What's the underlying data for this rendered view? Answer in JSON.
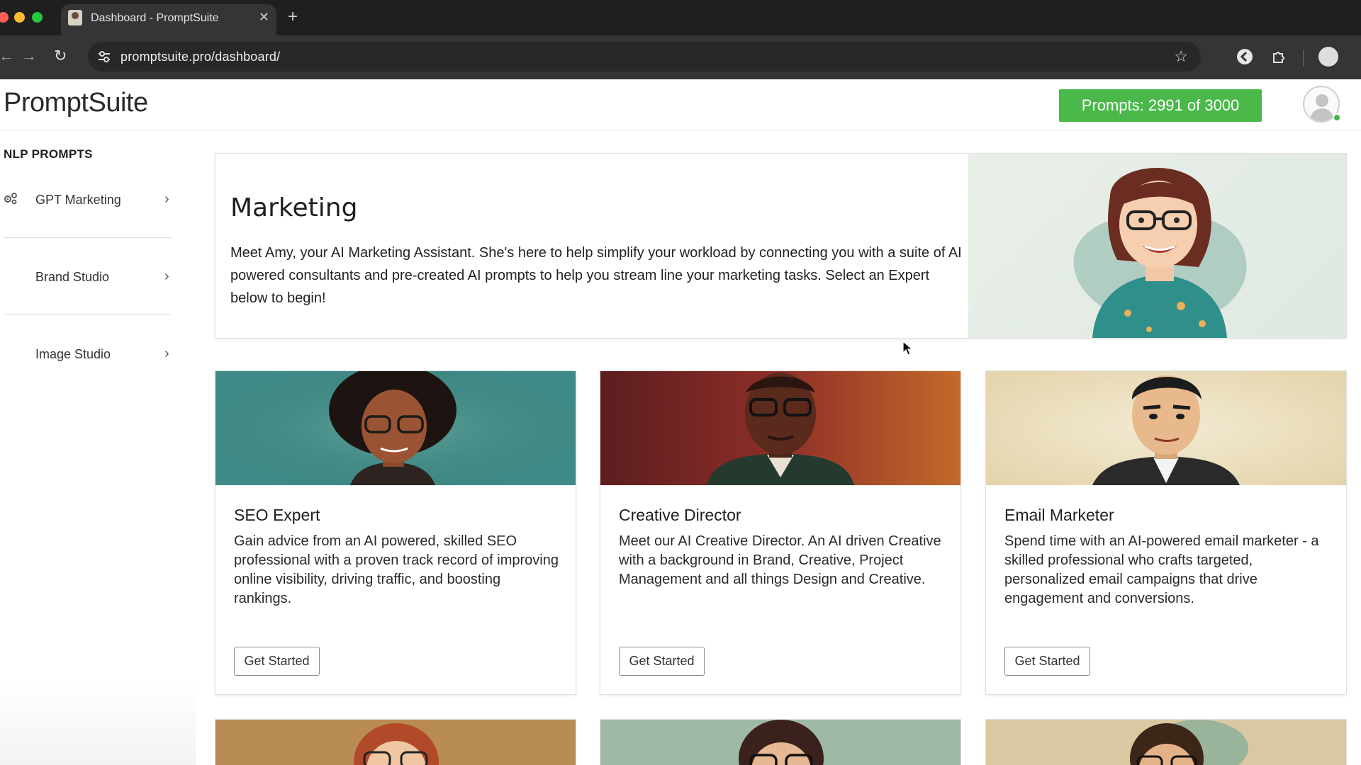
{
  "browser": {
    "tab_title": "Dashboard - PromptSuite",
    "url": "promptsuite.pro/dashboard/"
  },
  "header": {
    "logo": "PromptSuite",
    "prompts_badge": "Prompts: 2991 of 3000"
  },
  "sidebar": {
    "heading": "NLP PROMPTS",
    "items": [
      {
        "label": "GPT Marketing",
        "icon": "gear-icon"
      },
      {
        "label": "Brand Studio"
      },
      {
        "label": "Image Studio"
      }
    ]
  },
  "hero": {
    "title": "Marketing",
    "text": "Meet Amy, your AI Marketing Assistant. She's here to help simplify your workload by connecting you with a suite of AI powered consultants and pre-created AI prompts to help you stream line your marketing tasks. Select an Expert below to begin!"
  },
  "cards": [
    {
      "title": "SEO Expert",
      "desc": "Gain advice from an AI powered, skilled SEO professional with a proven track record of improving online visibility, driving traffic, and boosting rankings.",
      "button": "Get Started"
    },
    {
      "title": "Creative Director",
      "desc": "Meet our AI Creative Director. An AI driven Creative with a background in Brand, Creative, Project Management and all things Design and Creative.",
      "button": "Get Started"
    },
    {
      "title": "Email Marketer",
      "desc": "Spend time with an AI-powered email marketer - a skilled professional who crafts targeted, personalized email campaigns that drive engagement and conversions.",
      "button": "Get Started"
    }
  ],
  "colors": {
    "badge_green": "#4bb84a",
    "chrome_dark": "#1f1f1f",
    "chrome_mid": "#353535"
  }
}
